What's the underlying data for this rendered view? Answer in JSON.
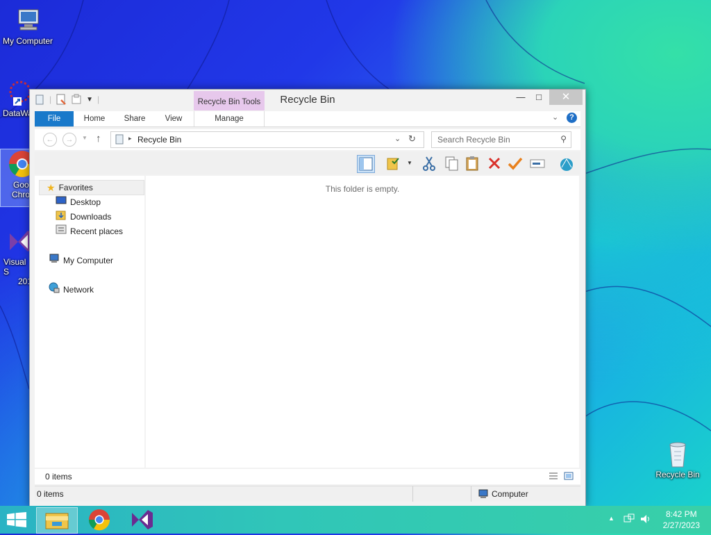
{
  "desktop": {
    "icons": [
      {
        "label": "My Computer"
      },
      {
        "label": "DataWa"
      },
      {
        "label": "Goo",
        "label2": "Chro"
      },
      {
        "label": "Visual S",
        "label2": "201"
      },
      {
        "label": "Recycle Bin"
      }
    ]
  },
  "window": {
    "title": "Recycle Bin",
    "context_tab": "Recycle Bin Tools",
    "controls": {
      "minimize": "—",
      "maximize": "□",
      "close": "✕"
    },
    "ribbon_tabs": [
      {
        "label": "File"
      },
      {
        "label": "Home"
      },
      {
        "label": "Share"
      },
      {
        "label": "View"
      },
      {
        "label": "Manage"
      }
    ],
    "address": {
      "path": "Recycle Bin"
    },
    "search": {
      "placeholder": "Search Recycle Bin"
    },
    "nav": {
      "favorites": "Favorites",
      "desktop": "Desktop",
      "downloads": "Downloads",
      "recent": "Recent places",
      "computer": "My Computer",
      "network": "Network"
    },
    "content": {
      "empty_message": "This folder is empty."
    },
    "status": {
      "items_top": "0 items",
      "items_bottom": "0 items",
      "location": "Computer"
    }
  },
  "taskbar": {
    "time": "8:42 PM",
    "date": "2/27/2023"
  },
  "colors": {
    "file_tab": "#1979ca",
    "context_tab": "#e7c8ec",
    "taskbar": "#30c6b8"
  }
}
